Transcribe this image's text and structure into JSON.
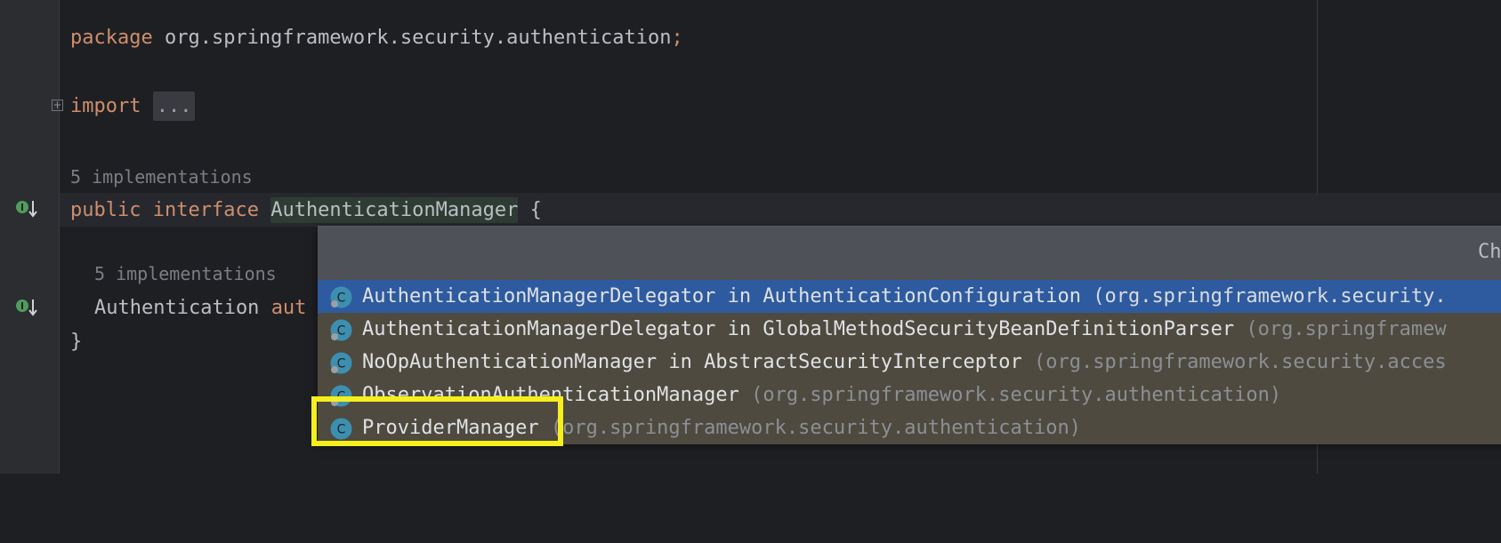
{
  "editor": {
    "package_kw": "package",
    "package_name": " org.springframework.security.authentication",
    "semicolon": ";",
    "import_kw": "import",
    "import_fold": "...",
    "fold_icon": "+",
    "hint_interface": "5 implementations",
    "public_kw": "public",
    "interface_kw": "interface",
    "interface_name": "AuthenticationManager",
    "open_brace": " {",
    "hint_method": "5 implementations",
    "method_type": "Authentication",
    "method_partial": "aut",
    "close_brace": "}"
  },
  "gutter_icons": [
    "implemented-interface-icon",
    "implemented-method-icon"
  ],
  "popup": {
    "header": "Ch",
    "items": [
      {
        "name": "AuthenticationManagerDelegator",
        "in_text": " in AuthenticationConfiguration",
        "package": " (org.springframework.security.",
        "selected": true
      },
      {
        "name": "AuthenticationManagerDelegator",
        "in_text": " in GlobalMethodSecurityBeanDefinitionParser",
        "package": " (org.springframew",
        "selected": false
      },
      {
        "name": "NoOpAuthenticationManager",
        "in_text": " in AbstractSecurityInterceptor",
        "package": " (org.springframework.security.acces",
        "selected": false
      },
      {
        "name": "ObservationAuthenticationManager",
        "in_text": "",
        "package": " (org.springframework.security.authentication)",
        "selected": false
      },
      {
        "name": "ProviderManager",
        "in_text": "",
        "package": " (org.springframework.security.authentication)",
        "selected": false
      }
    ]
  },
  "colors": {
    "keyword": "#cf8e6d",
    "selection": "#2e5b9f",
    "highlight_box": "#f5ef1b",
    "class_icon": "#3d8fb0"
  }
}
